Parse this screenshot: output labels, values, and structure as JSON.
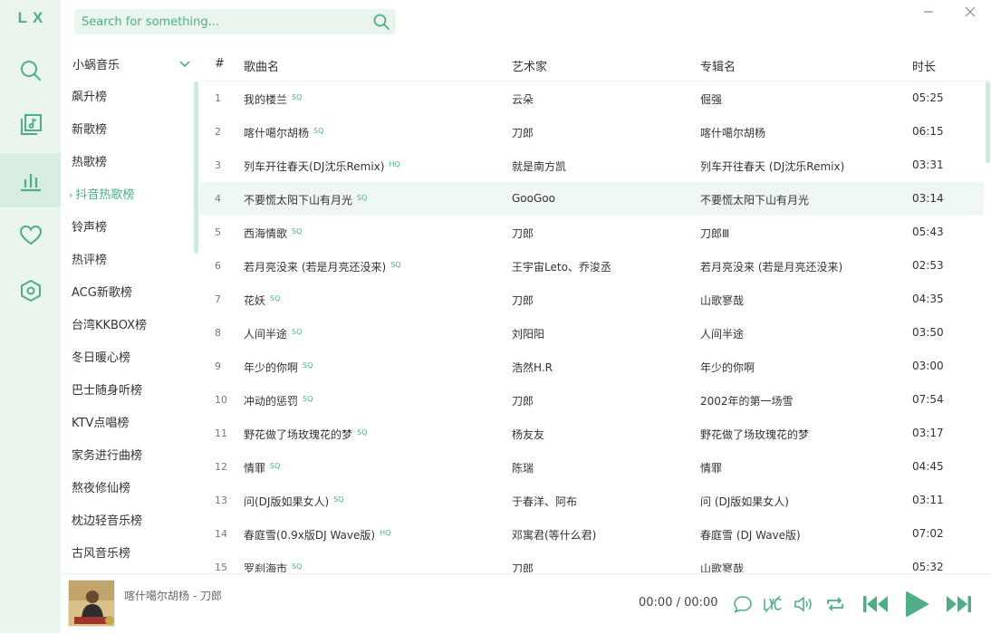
{
  "app": {
    "logo": "LX"
  },
  "colors": {
    "accent": "#4fae86",
    "rail_bg": "#eaf5ee",
    "rail_active": "#d6ede0",
    "row_highlight": "#eff7f2"
  },
  "nav": [
    {
      "name": "search",
      "icon": "search-icon"
    },
    {
      "name": "song-list",
      "icon": "music-list-icon"
    },
    {
      "name": "leaderboard",
      "icon": "bar-chart-icon",
      "active": true
    },
    {
      "name": "favorites",
      "icon": "heart-icon"
    },
    {
      "name": "settings",
      "icon": "settings-icon"
    }
  ],
  "search": {
    "placeholder": "Search for something..."
  },
  "source": {
    "selected": "小蜗音乐"
  },
  "boards": [
    {
      "label": "飙升榜"
    },
    {
      "label": "新歌榜"
    },
    {
      "label": "热歌榜"
    },
    {
      "label": "抖音热歌榜",
      "active": true
    },
    {
      "label": "铃声榜"
    },
    {
      "label": "热评榜"
    },
    {
      "label": "ACG新歌榜"
    },
    {
      "label": "台湾KKBOX榜"
    },
    {
      "label": "冬日暖心榜"
    },
    {
      "label": "巴士随身听榜"
    },
    {
      "label": "KTV点唱榜"
    },
    {
      "label": "家务进行曲榜"
    },
    {
      "label": "熬夜修仙榜"
    },
    {
      "label": "枕边轻音乐榜"
    },
    {
      "label": "古风音乐榜"
    }
  ],
  "table": {
    "headers": {
      "num": "#",
      "title": "歌曲名",
      "artist": "艺术家",
      "album": "专辑名",
      "duration": "时长"
    },
    "rows": [
      {
        "num": "1",
        "title": "我的楼兰",
        "quality": "SQ",
        "artist": "云朵",
        "album": "倔强",
        "duration": "05:25"
      },
      {
        "num": "2",
        "title": "喀什噶尔胡杨",
        "quality": "SQ",
        "artist": "刀郎",
        "album": "喀什噶尔胡杨",
        "duration": "06:15"
      },
      {
        "num": "3",
        "title": "列车开往春天(DJ沈乐Remix)",
        "quality": "HQ",
        "artist": "就是南方凯",
        "album": "列车开往春天 (DJ沈乐Remix)",
        "duration": "03:31"
      },
      {
        "num": "4",
        "title": "不要慌太阳下山有月光",
        "quality": "SQ",
        "artist": "GooGoo",
        "album": "不要慌太阳下山有月光",
        "duration": "03:14",
        "highlight": true
      },
      {
        "num": "5",
        "title": "西海情歌",
        "quality": "SQ",
        "artist": "刀郎",
        "album": "刀郎Ⅲ",
        "duration": "05:43"
      },
      {
        "num": "6",
        "title": "若月亮没来 (若是月亮还没来)",
        "quality": "SQ",
        "artist": "王宇宙Leto、乔浚丞",
        "album": "若月亮没来 (若是月亮还没来)",
        "duration": "02:53"
      },
      {
        "num": "7",
        "title": "花妖",
        "quality": "SQ",
        "artist": "刀郎",
        "album": "山歌寥哉",
        "duration": "04:35"
      },
      {
        "num": "8",
        "title": "人间半途",
        "quality": "SQ",
        "artist": "刘阳阳",
        "album": "人间半途",
        "duration": "03:50"
      },
      {
        "num": "9",
        "title": "年少的你啊",
        "quality": "SQ",
        "artist": "浩然H.R",
        "album": "年少的你啊",
        "duration": "03:00"
      },
      {
        "num": "10",
        "title": "冲动的惩罚",
        "quality": "SQ",
        "artist": "刀郎",
        "album": "2002年的第一场雪",
        "duration": "07:54"
      },
      {
        "num": "11",
        "title": "野花做了场玫瑰花的梦",
        "quality": "SQ",
        "artist": "杨友友",
        "album": "野花做了场玫瑰花的梦",
        "duration": "03:17"
      },
      {
        "num": "12",
        "title": "情罪",
        "quality": "SQ",
        "artist": "陈瑞",
        "album": "情罪",
        "duration": "04:45"
      },
      {
        "num": "13",
        "title": "问(DJ版如果女人)",
        "quality": "SQ",
        "artist": "于春洋、阿布",
        "album": "问 (DJ版如果女人)",
        "duration": "03:11"
      },
      {
        "num": "14",
        "title": "春庭雪(0.9x版DJ Wave版)",
        "quality": "HQ",
        "artist": "邓寓君(等什么君)",
        "album": "春庭雪 (DJ Wave版)",
        "duration": "07:02"
      },
      {
        "num": "15",
        "title": "罗刹海市",
        "quality": "SQ",
        "artist": "刀郎",
        "album": "山歌寥哉",
        "duration": "05:32"
      }
    ]
  },
  "player": {
    "now_playing": "喀什噶尔胡杨 - 刀郎",
    "time": "00:00 / 00:00"
  }
}
